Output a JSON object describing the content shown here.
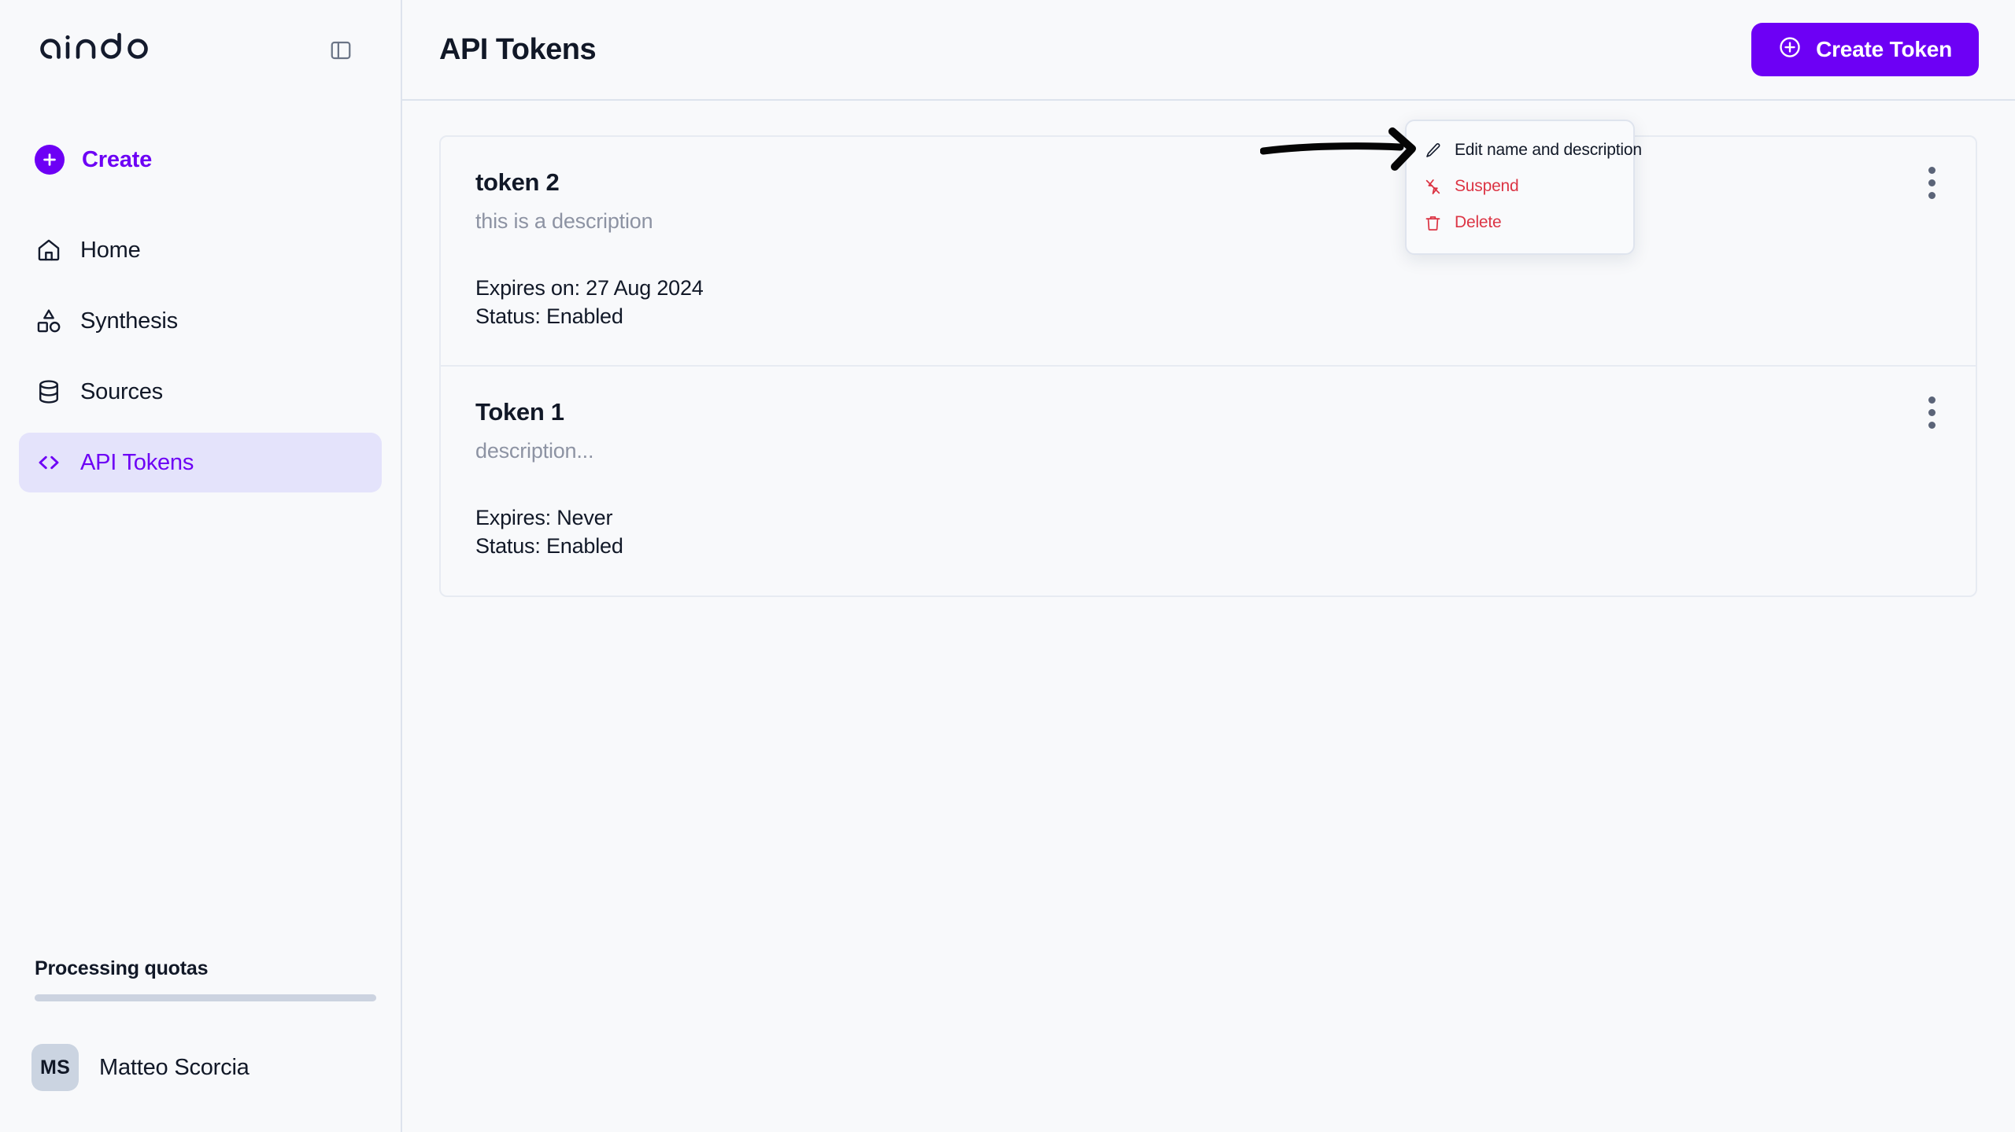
{
  "brand": {
    "name": "aindo"
  },
  "sidebar": {
    "panel_toggle_name": "panel-toggle-icon",
    "create": {
      "label": "Create",
      "icon": "plus-circle-filled-icon",
      "accent": "#6d00f5"
    },
    "items": [
      {
        "label": "Home",
        "icon": "home-icon",
        "active": false
      },
      {
        "label": "Synthesis",
        "icon": "shapes-icon",
        "active": false
      },
      {
        "label": "Sources",
        "icon": "database-icon",
        "active": false
      },
      {
        "label": "API Tokens",
        "icon": "code-icon",
        "active": true
      }
    ],
    "quota": {
      "label": "Processing quotas",
      "progress_percent": 0
    },
    "user": {
      "initials": "MS",
      "name": "Matteo Scorcia"
    }
  },
  "header": {
    "title": "API Tokens",
    "create_token": {
      "label": "Create Token",
      "icon": "plus-circle-icon",
      "color": "#6d00f5"
    }
  },
  "tokens": [
    {
      "name": "token 2",
      "description": "this is a description",
      "expires": "Expires on: 27 Aug 2024",
      "status": "Status: Enabled"
    },
    {
      "name": "Token 1",
      "description": "description...",
      "expires": "Expires: Never",
      "status": "Status: Enabled"
    }
  ],
  "dropdown": {
    "items": [
      {
        "label": "Edit name and description",
        "icon": "pencil-icon",
        "danger": false
      },
      {
        "label": "Suspend",
        "icon": "zap-off-icon",
        "danger": true
      },
      {
        "label": "Delete",
        "icon": "trash-icon",
        "danger": true
      }
    ],
    "danger_color": "#dc3545"
  },
  "annotation": {
    "type": "hand-drawn-arrow",
    "direction": "right",
    "color": "#000000"
  }
}
